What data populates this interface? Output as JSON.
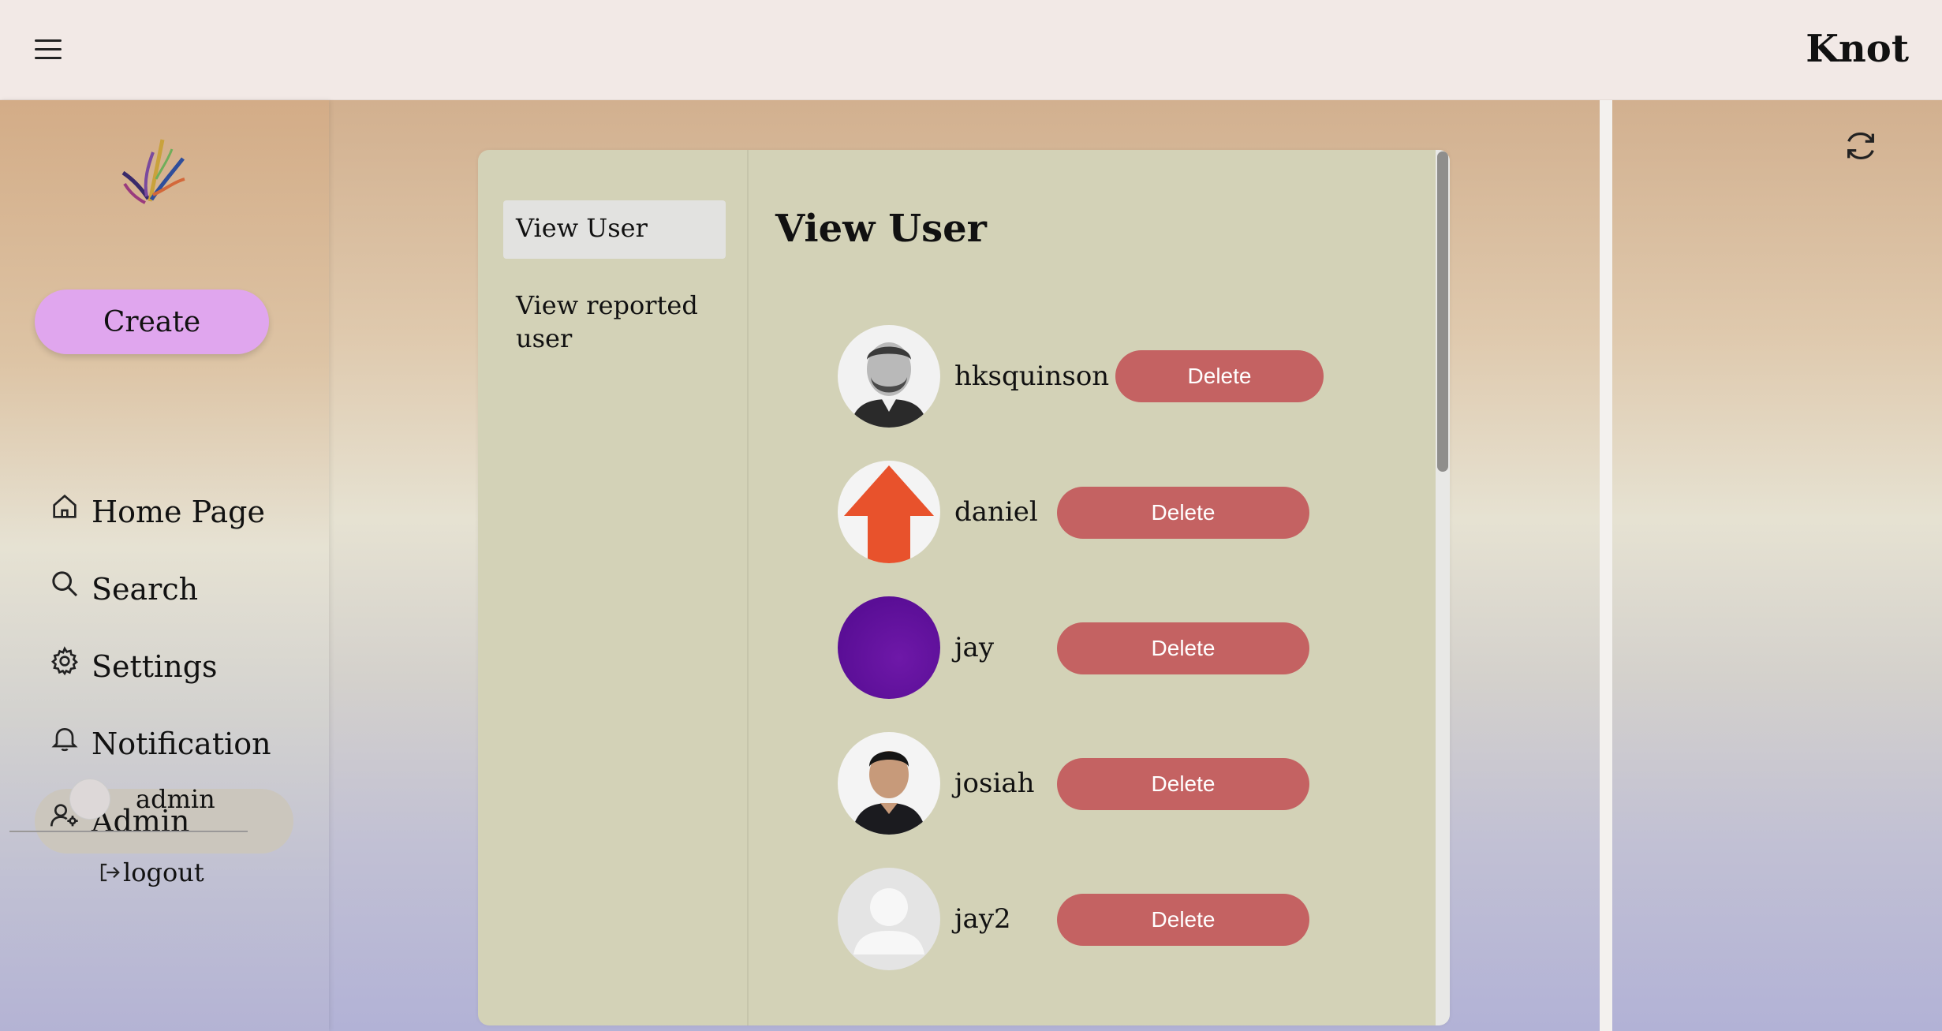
{
  "header": {
    "brand": "Knot",
    "menu_icon": "hamburger-icon"
  },
  "sidebar": {
    "create_label": "Create",
    "items": [
      {
        "label": "Home Page",
        "icon": "home-icon"
      },
      {
        "label": "Search",
        "icon": "search-icon"
      },
      {
        "label": "Settings",
        "icon": "gear-icon"
      },
      {
        "label": "Notification",
        "icon": "bell-icon"
      },
      {
        "label": "Admin",
        "icon": "user-admin-icon",
        "active": true
      }
    ],
    "user": {
      "name": "admin"
    },
    "logout_label": "logout"
  },
  "admin_panel": {
    "subnav": [
      {
        "label": "View User",
        "active": true
      },
      {
        "label": "View reported user"
      }
    ],
    "title": "View User",
    "users": [
      {
        "name": "hksquinson",
        "avatar": "photo-man"
      },
      {
        "name": "daniel",
        "avatar": "orange-arrow"
      },
      {
        "name": "jay",
        "avatar": "purple"
      },
      {
        "name": "josiah",
        "avatar": "photo-boy"
      },
      {
        "name": "jay2",
        "avatar": "default"
      }
    ],
    "delete_label": "Delete"
  },
  "colors": {
    "create_button": "#e0a6ee",
    "delete_button": "#c46262",
    "panel": "#d3d2b7"
  }
}
